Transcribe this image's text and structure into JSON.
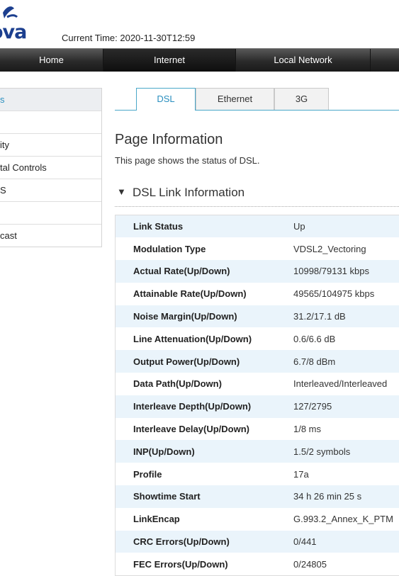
{
  "header": {
    "logo_text": "ova",
    "current_time_label": "Current Time: ",
    "current_time_value": "2020-11-30T12:59"
  },
  "nav": {
    "items": [
      {
        "label": "Home",
        "active": false
      },
      {
        "label": "Internet",
        "active": true
      },
      {
        "label": "Local Network",
        "active": false
      }
    ]
  },
  "sidebar": {
    "items": [
      {
        "label": "s",
        "active": true
      },
      {
        "label": ""
      },
      {
        "label": "ity"
      },
      {
        "label": "tal Controls"
      },
      {
        "label": "S"
      },
      {
        "label": ""
      },
      {
        "label": "cast"
      }
    ]
  },
  "tabs": {
    "items": [
      {
        "label": "DSL",
        "active": true
      },
      {
        "label": "Ethernet",
        "active": false
      },
      {
        "label": "3G",
        "active": false
      }
    ]
  },
  "page": {
    "title": "Page Information",
    "description": "This page shows the status of DSL.",
    "section_caret": "▼",
    "section_title": "DSL Link Information"
  },
  "dsl_info": {
    "rows": [
      {
        "label": "Link Status",
        "value": "Up"
      },
      {
        "label": "Modulation Type",
        "value": "VDSL2_Vectoring"
      },
      {
        "label": "Actual Rate(Up/Down)",
        "value": "10998/79131 kbps"
      },
      {
        "label": "Attainable Rate(Up/Down)",
        "value": "49565/104975 kbps"
      },
      {
        "label": "Noise Margin(Up/Down)",
        "value": "31.2/17.1 dB"
      },
      {
        "label": "Line Attenuation(Up/Down)",
        "value": "0.6/6.6 dB"
      },
      {
        "label": "Output Power(Up/Down)",
        "value": "6.7/8 dBm"
      },
      {
        "label": "Data Path(Up/Down)",
        "value": "Interleaved/Interleaved"
      },
      {
        "label": "Interleave Depth(Up/Down)",
        "value": "127/2795"
      },
      {
        "label": "Interleave Delay(Up/Down)",
        "value": "1/8 ms"
      },
      {
        "label": "INP(Up/Down)",
        "value": "1.5/2 symbols"
      },
      {
        "label": "Profile",
        "value": "17a"
      },
      {
        "label": "Showtime Start",
        "value": "34 h 26 min 25 s"
      },
      {
        "label": "LinkEncap",
        "value": "G.993.2_Annex_K_PTM"
      },
      {
        "label": "CRC Errors(Up/Down)",
        "value": "0/441"
      },
      {
        "label": "FEC Errors(Up/Down)",
        "value": "0/24805"
      }
    ]
  },
  "colors": {
    "accent": "#2a8fbf",
    "brand": "#1c3f8f",
    "row_highlight": "#eaf4fb",
    "navbar": "#2a2a2a"
  }
}
